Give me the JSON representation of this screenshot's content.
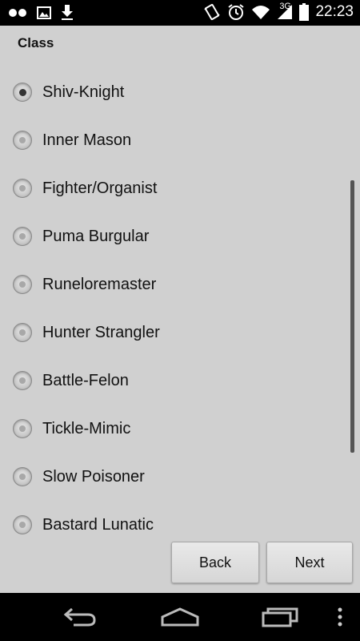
{
  "status_bar": {
    "time": "22:23",
    "network": "3G",
    "icons": [
      "dots-icon",
      "image-icon",
      "download-icon",
      "vibrate-icon",
      "alarm-icon",
      "wifi-icon",
      "signal-icon",
      "battery-icon"
    ]
  },
  "form": {
    "section_title": "Class",
    "selected_index": 0,
    "options": [
      {
        "label": "Shiv-Knight",
        "checked": true
      },
      {
        "label": "Inner Mason",
        "checked": false
      },
      {
        "label": "Fighter/Organist",
        "checked": false
      },
      {
        "label": "Puma Burgular",
        "checked": false
      },
      {
        "label": "Runeloremaster",
        "checked": false
      },
      {
        "label": "Hunter Strangler",
        "checked": false
      },
      {
        "label": "Battle-Felon",
        "checked": false
      },
      {
        "label": "Tickle-Mimic",
        "checked": false
      },
      {
        "label": "Slow Poisoner",
        "checked": false
      },
      {
        "label": "Bastard Lunatic",
        "checked": false
      }
    ]
  },
  "buttons": {
    "back_label": "Back",
    "next_label": "Next"
  },
  "nav_bar": {
    "icons": [
      "back-icon",
      "home-icon",
      "recents-icon",
      "overflow-menu-icon"
    ]
  }
}
